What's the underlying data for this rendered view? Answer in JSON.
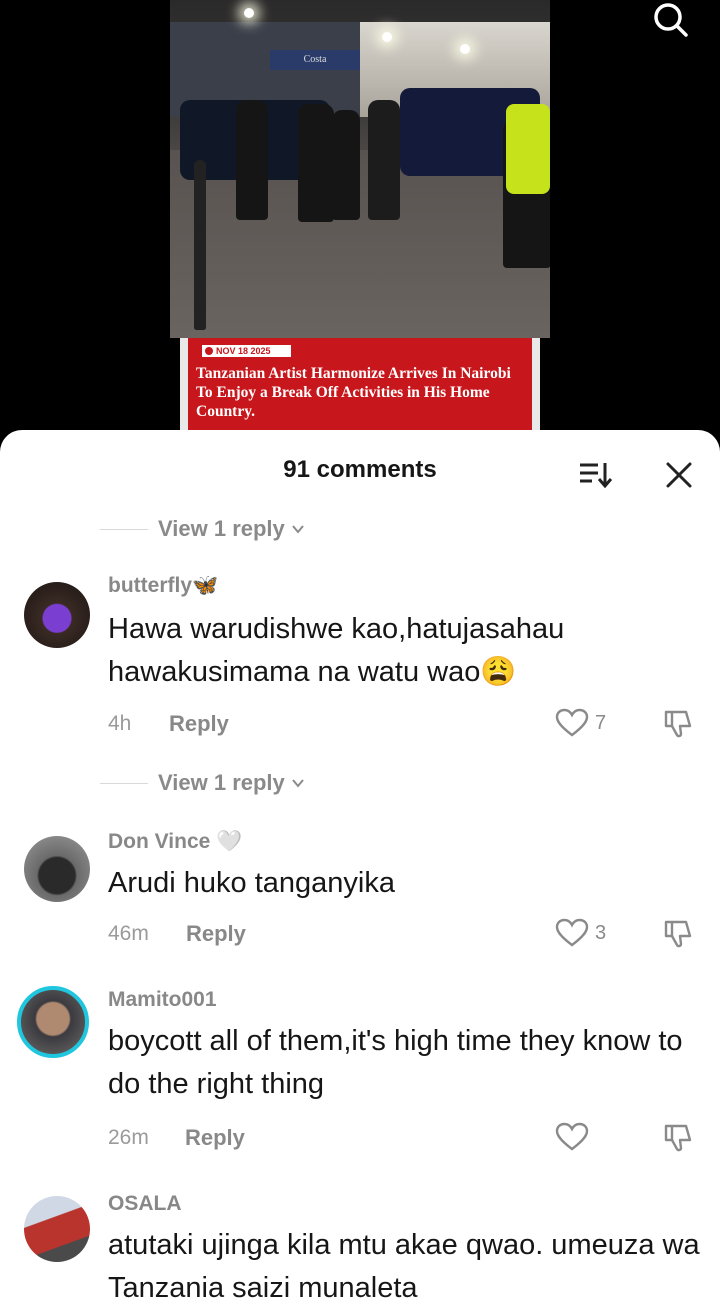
{
  "video": {
    "store_sign": "Costa",
    "banner_date": "NOV 18 2025",
    "banner_headline": "Tanzanian Artist Harmonize Arrives In Nairobi To Enjoy a Break Off Activities in His Home Country."
  },
  "comments_sheet": {
    "title": "91 comments",
    "view_reply_label": "View 1 reply",
    "reply_label": "Reply",
    "comments": [
      {
        "username": "butterfly🦋",
        "text": "Hawa warudishwe kao,hatujasahau hawakusimama na watu wao😩",
        "time": "4h",
        "likes": "7"
      },
      {
        "username": "Don Vince 🤍",
        "text": "Arudi huko tanganyika",
        "time": "46m",
        "likes": "3"
      },
      {
        "username": "Mamito001",
        "text": "boycott all of them,it's high time they know to do the right thing",
        "time": "26m",
        "likes": ""
      },
      {
        "username": "OSALA",
        "text": "atutaki ujinga kila mtu akae qwao. umeuza wa Tanzania saizi munaleta",
        "time": "",
        "likes": ""
      }
    ]
  },
  "colors": {
    "banner_red": "#c8171c",
    "avatar_ring": "#1fc6de",
    "muted_text": "#888888"
  },
  "icons": [
    "search-icon",
    "sort-icon",
    "close-icon",
    "chevron-down-icon",
    "heart-icon",
    "dislike-icon"
  ]
}
